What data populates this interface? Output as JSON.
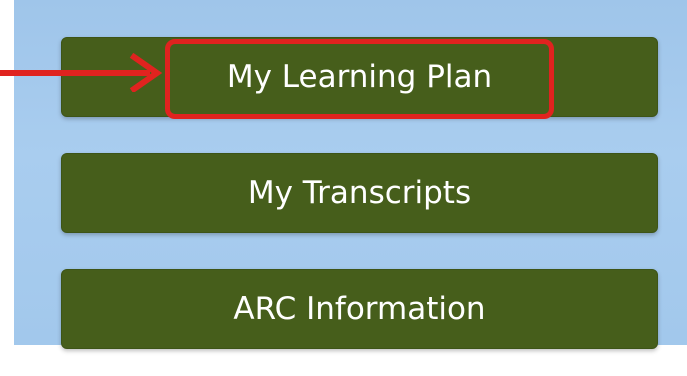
{
  "menu": {
    "items": [
      {
        "label": "My Learning Plan"
      },
      {
        "label": "My Transcripts"
      },
      {
        "label": "ARC Information"
      }
    ]
  },
  "annotation": {
    "color": "#e0231f",
    "target": "My Learning Plan"
  },
  "colors": {
    "button_bg": "#465e1b",
    "panel_bg": "#a9cdef",
    "text": "#ffffff"
  }
}
